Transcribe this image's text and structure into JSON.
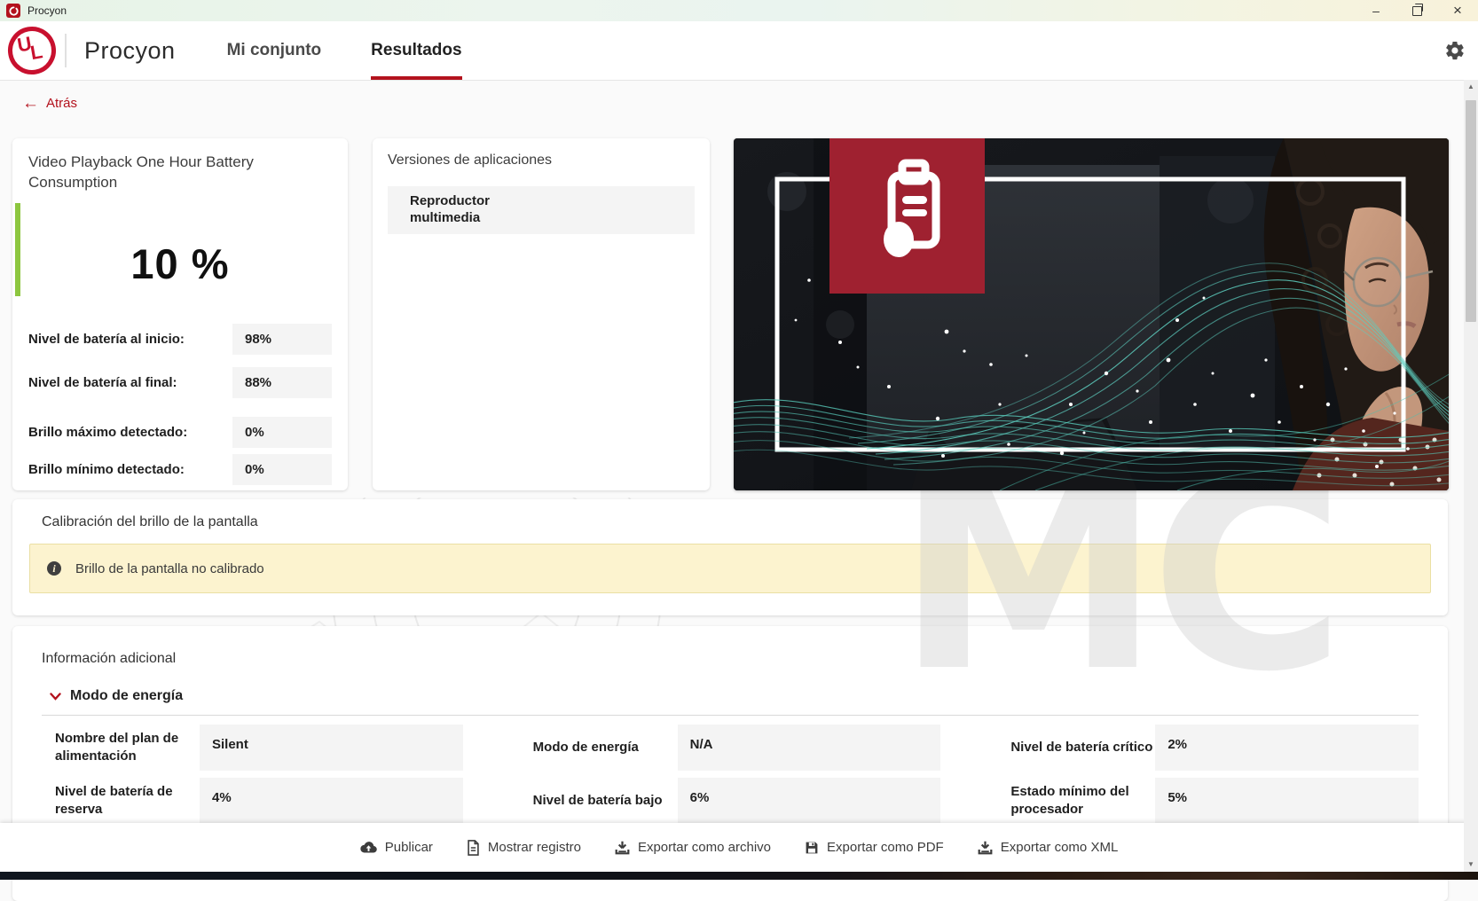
{
  "titlebar": {
    "app_title": "Procyon"
  },
  "icons": {
    "minimize": "–",
    "close": "×",
    "back_arrow": "←",
    "scroll_up": "▲",
    "scroll_down": "▼",
    "info": "i",
    "watermark_letters": "MC"
  },
  "header": {
    "brand": "Procyon",
    "tabs": [
      {
        "label": "Mi conjunto",
        "active": false
      },
      {
        "label": "Resultados",
        "active": true
      }
    ]
  },
  "back_link": {
    "label": "Atrás"
  },
  "score_card": {
    "title": "Video Playback One Hour Battery Consumption",
    "score": "10 %",
    "metrics": [
      {
        "label": "Nivel de batería al inicio:",
        "value": "98%"
      },
      {
        "label": "Nivel de batería al final:",
        "value": "88%"
      },
      {
        "label": "Brillo máximo detectado:",
        "value": "0%"
      },
      {
        "label": "Brillo mínimo detectado:",
        "value": "0%"
      }
    ]
  },
  "versions_card": {
    "title": "Versiones de aplicaciones",
    "items": [
      {
        "name": "Reproductor multimedia"
      }
    ]
  },
  "calibration": {
    "title": "Calibración del brillo de la pantalla",
    "alert_text": "Brillo de la pantalla no calibrado"
  },
  "additional_info": {
    "title": "Información adicional",
    "section_title": "Modo de energía",
    "fields": [
      {
        "label": "Nombre del plan de alimentación",
        "value": "Silent"
      },
      {
        "label": "Modo de energía",
        "value": "N/A"
      },
      {
        "label": "Nivel de batería crítico",
        "value": "2%"
      },
      {
        "label": "Nivel de batería de reserva",
        "value": "4%"
      },
      {
        "label": "Nivel de batería bajo",
        "value": "6%"
      },
      {
        "label": "Estado mínimo del procesador",
        "value": "5%"
      }
    ]
  },
  "footer": {
    "buttons": [
      {
        "label": "Publicar",
        "icon": "cloud-upload-icon"
      },
      {
        "label": "Mostrar registro",
        "icon": "document-icon"
      },
      {
        "label": "Exportar como archivo",
        "icon": "download-icon"
      },
      {
        "label": "Exportar como PDF",
        "icon": "save-icon"
      },
      {
        "label": "Exportar como XML",
        "icon": "download-icon"
      }
    ]
  },
  "colors": {
    "accent_red": "#b3121d",
    "ul_logo_red": "#c8102e",
    "hero_badge_red": "#9f2130",
    "score_accent_green": "#8dc63f",
    "alert_background": "#fcf3cf",
    "alert_border": "#eadfa3",
    "wave_teal": "#57c9b9",
    "titlebar_gradient_left": "#e7f3e7",
    "titlebar_gradient_right": "#f8f2da"
  }
}
